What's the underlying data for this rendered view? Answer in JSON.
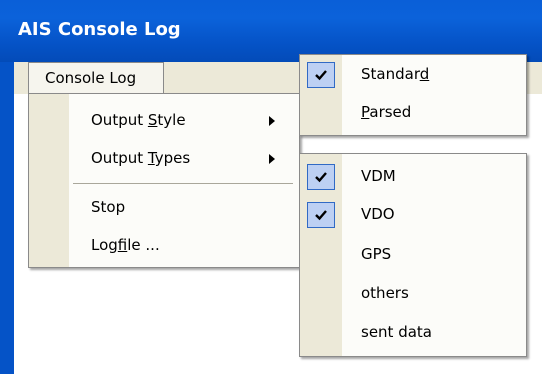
{
  "window": {
    "title": "AIS Console Log"
  },
  "menubar": {
    "console_log": "Console Log"
  },
  "console_menu": {
    "output_style": "Output Style",
    "output_types": "Output Types",
    "stop": "Stop",
    "logfile": "Logfile ..."
  },
  "style_submenu": [
    {
      "label": "Standard",
      "checked": true
    },
    {
      "label": "Parsed",
      "checked": false
    }
  ],
  "types_submenu": [
    {
      "label": "VDM",
      "checked": true
    },
    {
      "label": "VDO",
      "checked": true
    },
    {
      "label": "GPS",
      "checked": false
    },
    {
      "label": "others",
      "checked": false
    },
    {
      "label": "sent data",
      "checked": false
    }
  ],
  "colors": {
    "titlebar": "#0553c7",
    "menu_bg": "#fcfcf9",
    "gutter": "#ece9d8",
    "check_highlight": "#bdd0f3"
  },
  "icons": {
    "check": "check-icon",
    "submenu_arrow": "triangle-right-icon"
  }
}
